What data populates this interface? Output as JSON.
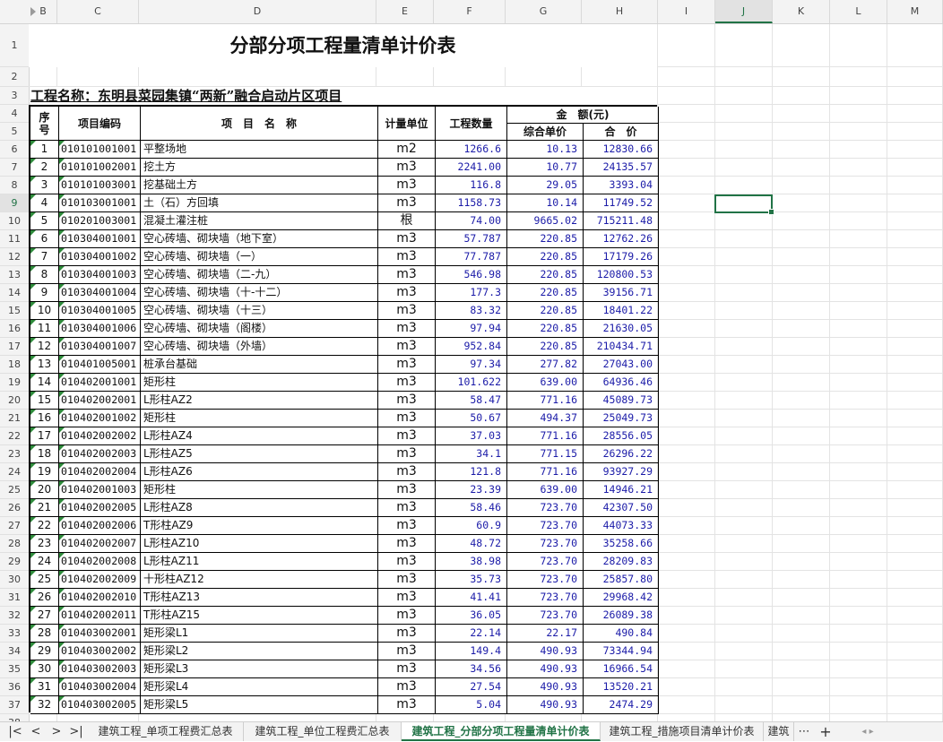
{
  "columns": [
    "B",
    "C",
    "D",
    "E",
    "F",
    "G",
    "H",
    "I",
    "J",
    "K",
    "L",
    "M"
  ],
  "selected_column": "J",
  "rows_visible": [
    "1",
    "2",
    "3",
    "4",
    "5",
    "6",
    "7",
    "8",
    "9",
    "10",
    "11",
    "12",
    "13",
    "14",
    "15",
    "16",
    "17",
    "18",
    "19",
    "20",
    "21",
    "22",
    "23",
    "24",
    "25",
    "26",
    "27",
    "28",
    "29",
    "30",
    "31",
    "32",
    "33",
    "34",
    "35",
    "36",
    "37",
    "38"
  ],
  "selected_row": "9",
  "sheet": {
    "title": "分部分项工程量清单计价表",
    "project_label": "工程名称：东明县菜园集镇“两新”融合启动片区项目",
    "headers": {
      "seq": "序号",
      "code": "项目编码",
      "name": "项　目　名　称",
      "unit": "计量单位",
      "qty": "工程数量",
      "amount": "金　额(元)",
      "unit_price": "综合单价",
      "total": "合　价"
    },
    "rows": [
      [
        "1",
        "010101001001",
        "平整场地",
        "m2",
        "1266.6",
        "10.13",
        "12830.66"
      ],
      [
        "2",
        "010101002001",
        "挖土方",
        "m3",
        "2241.00",
        "10.77",
        "24135.57"
      ],
      [
        "3",
        "010101003001",
        "挖基础土方",
        "m3",
        "116.8",
        "29.05",
        "3393.04"
      ],
      [
        "4",
        "010103001001",
        "土（石）方回填",
        "m3",
        "1158.73",
        "10.14",
        "11749.52"
      ],
      [
        "5",
        "010201003001",
        "混凝土灌注桩",
        "根",
        "74.00",
        "9665.02",
        "715211.48"
      ],
      [
        "6",
        "010304001001",
        "空心砖墙、砌块墙（地下室）",
        "m3",
        "57.787",
        "220.85",
        "12762.26"
      ],
      [
        "7",
        "010304001002",
        "空心砖墙、砌块墙（一）",
        "m3",
        "77.787",
        "220.85",
        "17179.26"
      ],
      [
        "8",
        "010304001003",
        "空心砖墙、砌块墙（二-九）",
        "m3",
        "546.98",
        "220.85",
        "120800.53"
      ],
      [
        "9",
        "010304001004",
        "空心砖墙、砌块墙（十-十二）",
        "m3",
        "177.3",
        "220.85",
        "39156.71"
      ],
      [
        "10",
        "010304001005",
        "空心砖墙、砌块墙（十三）",
        "m3",
        "83.32",
        "220.85",
        "18401.22"
      ],
      [
        "11",
        "010304001006",
        "空心砖墙、砌块墙（阁楼）",
        "m3",
        "97.94",
        "220.85",
        "21630.05"
      ],
      [
        "12",
        "010304001007",
        "空心砖墙、砌块墙（外墙）",
        "m3",
        "952.84",
        "220.85",
        "210434.71"
      ],
      [
        "13",
        "010401005001",
        "桩承台基础",
        "m3",
        "97.34",
        "277.82",
        "27043.00"
      ],
      [
        "14",
        "010402001001",
        "矩形柱",
        "m3",
        "101.622",
        "639.00",
        "64936.46"
      ],
      [
        "15",
        "010402002001",
        "L形柱AZ2",
        "m3",
        "58.47",
        "771.16",
        "45089.73"
      ],
      [
        "16",
        "010402001002",
        "矩形柱",
        "m3",
        "50.67",
        "494.37",
        "25049.73"
      ],
      [
        "17",
        "010402002002",
        "L形柱AZ4",
        "m3",
        "37.03",
        "771.16",
        "28556.05"
      ],
      [
        "18",
        "010402002003",
        "L形柱AZ5",
        "m3",
        "34.1",
        "771.15",
        "26296.22"
      ],
      [
        "19",
        "010402002004",
        "L形柱AZ6",
        "m3",
        "121.8",
        "771.16",
        "93927.29"
      ],
      [
        "20",
        "010402001003",
        "矩形柱",
        "m3",
        "23.39",
        "639.00",
        "14946.21"
      ],
      [
        "21",
        "010402002005",
        "L形柱AZ8",
        "m3",
        "58.46",
        "723.70",
        "42307.50"
      ],
      [
        "22",
        "010402002006",
        "T形柱AZ9",
        "m3",
        "60.9",
        "723.70",
        "44073.33"
      ],
      [
        "23",
        "010402002007",
        "L形柱AZ10",
        "m3",
        "48.72",
        "723.70",
        "35258.66"
      ],
      [
        "24",
        "010402002008",
        "L形柱AZ11",
        "m3",
        "38.98",
        "723.70",
        "28209.83"
      ],
      [
        "25",
        "010402002009",
        "十形柱AZ12",
        "m3",
        "35.73",
        "723.70",
        "25857.80"
      ],
      [
        "26",
        "010402002010",
        "T形柱AZ13",
        "m3",
        "41.41",
        "723.70",
        "29968.42"
      ],
      [
        "27",
        "010402002011",
        "T形柱AZ15",
        "m3",
        "36.05",
        "723.70",
        "26089.38"
      ],
      [
        "28",
        "010403002001",
        "矩形梁L1",
        "m3",
        "22.14",
        "22.17",
        "490.84"
      ],
      [
        "29",
        "010403002002",
        "矩形梁L2",
        "m3",
        "149.4",
        "490.93",
        "73344.94"
      ],
      [
        "30",
        "010403002003",
        "矩形梁L3",
        "m3",
        "34.56",
        "490.93",
        "16966.54"
      ],
      [
        "31",
        "010403002004",
        "矩形梁L4",
        "m3",
        "27.54",
        "490.93",
        "13520.21"
      ],
      [
        "32",
        "010403002005",
        "矩形梁L5",
        "m3",
        "5.04",
        "490.93",
        "2474.29"
      ]
    ]
  },
  "tabs": [
    "建筑工程_单项工程费汇总表",
    "建筑工程_单位工程费汇总表",
    "建筑工程_分部分项工程量清单计价表",
    "建筑工程_措施项目清单计价表",
    "建筑"
  ],
  "active_tab": 2,
  "tab_nav": {
    "first": "|<",
    "prev": "<",
    "next": ">",
    "last": ">|",
    "more": "⋯",
    "add": "+"
  },
  "colors": {
    "accent": "#217346",
    "number": "#1b1ba8"
  }
}
